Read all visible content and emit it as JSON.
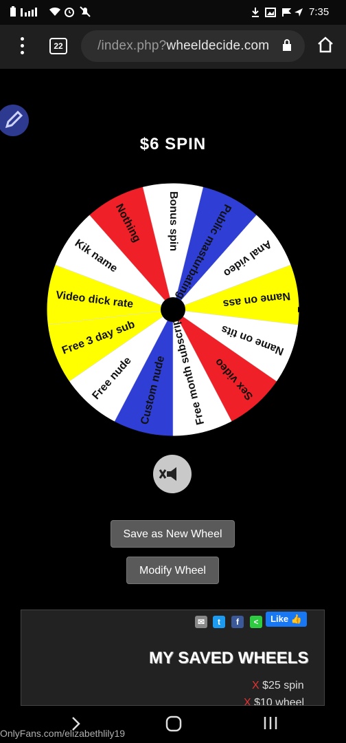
{
  "status_bar": {
    "time": "7:35"
  },
  "browser": {
    "url_host": "wheeldecide.com",
    "url_path": "/index.php?",
    "tab_count": "22"
  },
  "wheel": {
    "title": "$6 SPIN",
    "segments": [
      {
        "label": "Bonus spin",
        "color": "#ffffff"
      },
      {
        "label": "Public masturbating v",
        "color": "#2f3fd6"
      },
      {
        "label": "Anal video",
        "color": "#ffffff"
      },
      {
        "label": "Name on ass",
        "color": "#ffff00"
      },
      {
        "label": "Name on tits",
        "color": "#ffffff"
      },
      {
        "label": "Sex video",
        "color": "#ef2027"
      },
      {
        "label": "Free month subscriptio",
        "color": "#ffffff"
      },
      {
        "label": "Custom nude",
        "color": "#2f3fd6"
      },
      {
        "label": "Free nude",
        "color": "#ffffff"
      },
      {
        "label": "Free 3 day sub",
        "color": "#ffff00"
      },
      {
        "label": "Video dick rate",
        "color": "#ffff00"
      },
      {
        "label": "Kik name",
        "color": "#ffffff"
      },
      {
        "label": "Nothing",
        "color": "#ef2027"
      }
    ]
  },
  "buttons": {
    "save_new": "Save as New Wheel",
    "modify": "Modify Wheel"
  },
  "saved": {
    "like_label": "Like",
    "heading": "MY SAVED WHEELS",
    "items": [
      {
        "name": "$25 spin",
        "remove": "X"
      },
      {
        "name": "$10 wheel",
        "remove": "X"
      }
    ]
  },
  "watermark": "OnlyFans.com/elizabethlily19",
  "colors": {
    "blue": "#2f3fd6",
    "red": "#ef2027",
    "yellow": "#ffff00",
    "like": "#1877f2"
  }
}
